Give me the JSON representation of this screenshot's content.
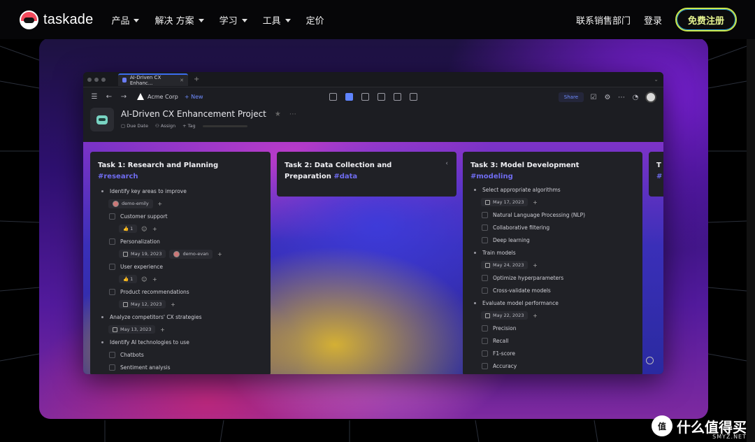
{
  "nav": {
    "logo_text": "taskade",
    "menu": [
      {
        "label": "产品"
      },
      {
        "label": "解决 方案"
      },
      {
        "label": "学习"
      },
      {
        "label": "工具"
      },
      {
        "label": "定价"
      }
    ],
    "contact_sales": "联系销售部门",
    "login": "登录",
    "signup": "免费注册"
  },
  "app": {
    "tab_title": "AI-Driven CX Enhanc...",
    "workspace": "Acme Corp",
    "new_label": "+ New",
    "share_label": "Share",
    "project_title": "AI-Driven CX Enhancement Project",
    "meta": {
      "due_date": "Due Date",
      "assign": "Assign",
      "tag": "Tag"
    }
  },
  "columns": [
    {
      "title": "Task 1: Research and Planning",
      "hashtag": "#research",
      "items": [
        {
          "type": "bullet",
          "text": "Identify key areas to improve"
        },
        {
          "type": "chips",
          "chips": [
            "demo-emily"
          ]
        },
        {
          "type": "check",
          "text": "Customer support"
        },
        {
          "type": "chips",
          "chips": [
            "👍 1"
          ]
        },
        {
          "type": "check",
          "text": "Personalization"
        },
        {
          "type": "chips",
          "chips": [
            "May 19, 2023",
            "demo-evan"
          ]
        },
        {
          "type": "check",
          "text": "User experience"
        },
        {
          "type": "chips",
          "chips": [
            "👍 1"
          ]
        },
        {
          "type": "check",
          "text": "Product recommendations"
        },
        {
          "type": "chips",
          "chips": [
            "May 12, 2023"
          ]
        },
        {
          "type": "bullet",
          "text": "Analyze competitors' CX strategies"
        },
        {
          "type": "chips",
          "chips": [
            "May 13, 2023"
          ]
        },
        {
          "type": "bullet",
          "text": "Identify AI technologies to use"
        },
        {
          "type": "check",
          "text": "Chatbots"
        },
        {
          "type": "check",
          "text": "Sentiment analysis"
        }
      ]
    },
    {
      "title": "Task 2: Data Collection and Preparation",
      "hashtag": "#data",
      "items": []
    },
    {
      "title": "Task 3: Model Development",
      "hashtag": "#modeling",
      "items": [
        {
          "type": "bullet",
          "text": "Select appropriate algorithms"
        },
        {
          "type": "chips",
          "chips": [
            "May 17, 2023"
          ]
        },
        {
          "type": "check",
          "text": "Natural Language Processing (NLP)"
        },
        {
          "type": "check",
          "text": "Collaborative filtering"
        },
        {
          "type": "check",
          "text": "Deep learning"
        },
        {
          "type": "bullet",
          "text": "Train models"
        },
        {
          "type": "chips",
          "chips": [
            "May 24, 2023"
          ]
        },
        {
          "type": "check",
          "text": "Optimize hyperparameters"
        },
        {
          "type": "check",
          "text": "Cross-validate models"
        },
        {
          "type": "bullet",
          "text": "Evaluate model performance"
        },
        {
          "type": "chips",
          "chips": [
            "May 22, 2023"
          ]
        },
        {
          "type": "check",
          "text": "Precision"
        },
        {
          "type": "check",
          "text": "Recall"
        },
        {
          "type": "check",
          "text": "F1-score"
        },
        {
          "type": "check",
          "text": "Accuracy"
        }
      ]
    },
    {
      "title": "T",
      "hashtag": "#",
      "items": []
    }
  ],
  "watermark": {
    "text": "什么值得买",
    "sub": "SMYZ.NET"
  }
}
